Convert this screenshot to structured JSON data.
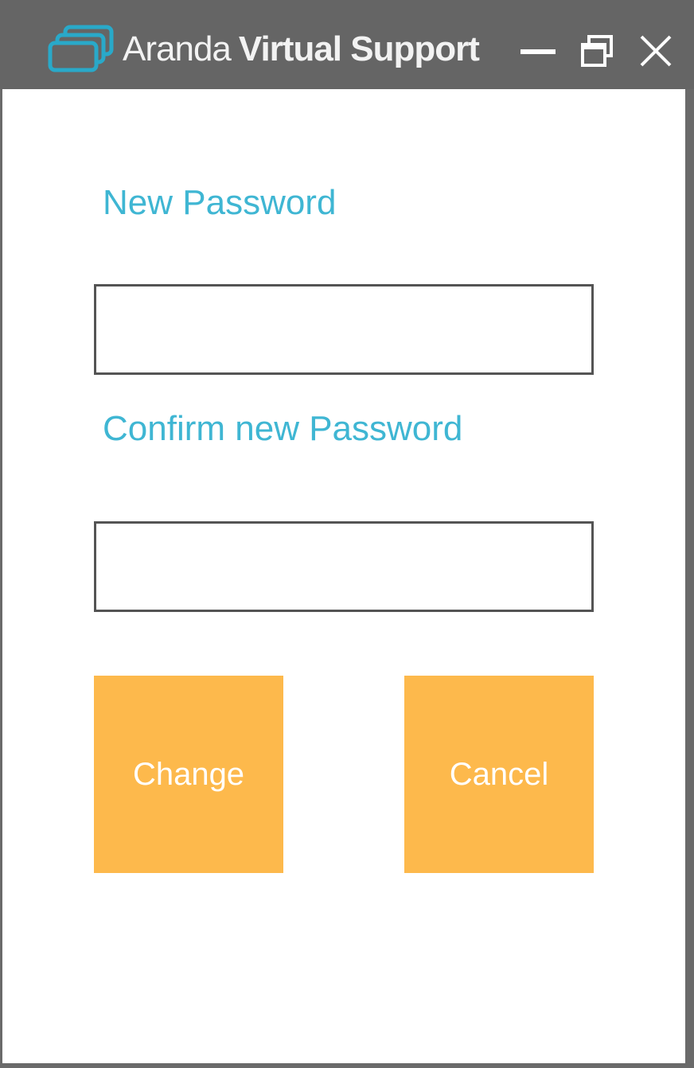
{
  "window": {
    "title_light": "Aranda",
    "title_bold": "Virtual Support",
    "logo_icon": "stacked-screens-icon",
    "controls": {
      "minimize_icon": "minimize-icon",
      "restore_icon": "restore-icon",
      "close_icon": "close-icon"
    }
  },
  "form": {
    "new_password_label": "New Password",
    "new_password_value": "",
    "confirm_password_label": "Confirm new Password",
    "confirm_password_value": "",
    "change_label": "Change",
    "cancel_label": "Cancel"
  },
  "colors": {
    "titlebar": "#656565",
    "accent_text": "#3fb6d3",
    "button": "#fdb94c",
    "logo": "#29a9c9"
  }
}
